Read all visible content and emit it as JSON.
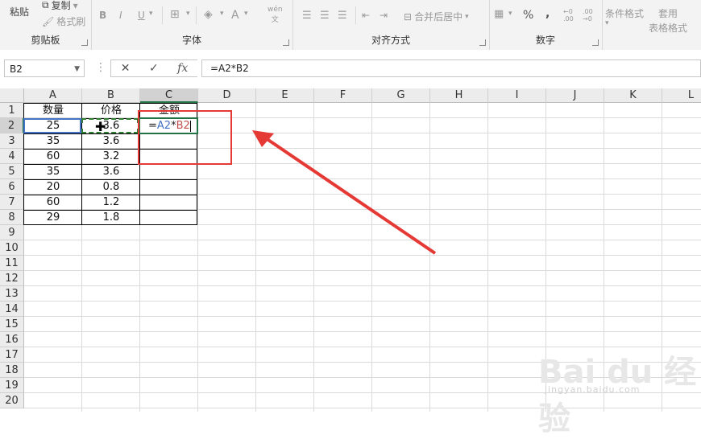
{
  "ribbon": {
    "clipboard": {
      "paste": "粘贴",
      "copy": "复制",
      "format_painter": "格式刷",
      "group_label": "剪贴板"
    },
    "font": {
      "bold": "B",
      "italic": "I",
      "underline": "U",
      "font_color_glyph": "A",
      "phonetic_top": "wén",
      "phonetic_bottom": "文",
      "group_label": "字体"
    },
    "alignment": {
      "merge_center": "合并后居中",
      "group_label": "对齐方式"
    },
    "number": {
      "percent": "%",
      "comma": ",",
      "group_label": "数字"
    },
    "styles": {
      "conditional_format": "条件格式",
      "table_format_top": "套用",
      "table_format_bottom": "表格格式"
    }
  },
  "formula_bar": {
    "name_box": "B2",
    "cancel": "✕",
    "enter": "✓",
    "fx": "fx",
    "formula": "=A2*B2"
  },
  "columns": [
    "A",
    "B",
    "C",
    "D",
    "E",
    "F",
    "G",
    "H",
    "I",
    "J",
    "K",
    "L"
  ],
  "rows": [
    "1",
    "2",
    "3",
    "4",
    "5",
    "6",
    "7",
    "8",
    "9",
    "10",
    "11",
    "12",
    "13",
    "14",
    "15",
    "16",
    "17",
    "18",
    "19",
    "20"
  ],
  "table": {
    "headers": [
      "数量",
      "价格",
      "金额"
    ],
    "quantity": [
      "25",
      "35",
      "60",
      "35",
      "20",
      "60",
      "29"
    ],
    "price": [
      "3.6",
      "3.6",
      "3.2",
      "3.6",
      "0.8",
      "1.2",
      "1.8"
    ]
  },
  "active_cell_formula": {
    "eq": "=",
    "ref1": "A2",
    "op": "*",
    "ref2": "B2"
  },
  "colors": {
    "accent": "#217346",
    "ref_a2": "#4472c4",
    "ref_b2": "#c0504d",
    "annotation": "#e53935"
  },
  "watermark": {
    "main": "Bai du 经验",
    "sub": "jingyan.baidu.com"
  }
}
